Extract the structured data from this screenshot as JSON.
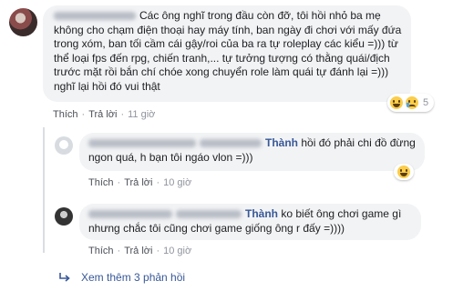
{
  "comment": {
    "author": "Thành",
    "text": "Các ông nghĩ trong đầu còn đỡ, tôi hồi nhỏ ba mẹ không cho chạm điện thoại hay máy tính, ban ngày đi chơi với mấy đứa trong xóm, ban tối cầm cái gậy/roi của ba ra tự roleplay các kiểu =))) từ thể loại fps đến rpg, chiến tranh,... tự tưởng tượng có thằng quái/địch trước mặt rồi bắn chí chóe xong chuyển role làm quái tự đánh lại =))) nghĩ lại hồi đó vui thật",
    "like_label": "Thích",
    "reply_label": "Trả lời",
    "time": "11 giờ",
    "reaction_count": "5",
    "reaction_icons": [
      "haha-icon",
      "sad-icon"
    ]
  },
  "replies": [
    {
      "mention": "Thành",
      "text": "hồi đó phải chi đồ đừng ngon quá, h bạn tôi ngáo vlon =)))",
      "like_label": "Thích",
      "reply_label": "Trả lời",
      "time": "10 giờ",
      "reaction_icons": [
        "haha-icon"
      ]
    },
    {
      "mention": "Thành",
      "text": "ko biết ông chơi game gì nhưng chắc tôi cũng chơi game giống ông r đấy =))))",
      "like_label": "Thích",
      "reply_label": "Trả lời",
      "time": "10 giờ"
    }
  ],
  "more_replies_label": "Xem thêm 3 phản hồi",
  "separator": "·",
  "colors": {
    "link": "#385898",
    "bubble": "#f2f3f5",
    "meta": "#90949c"
  }
}
